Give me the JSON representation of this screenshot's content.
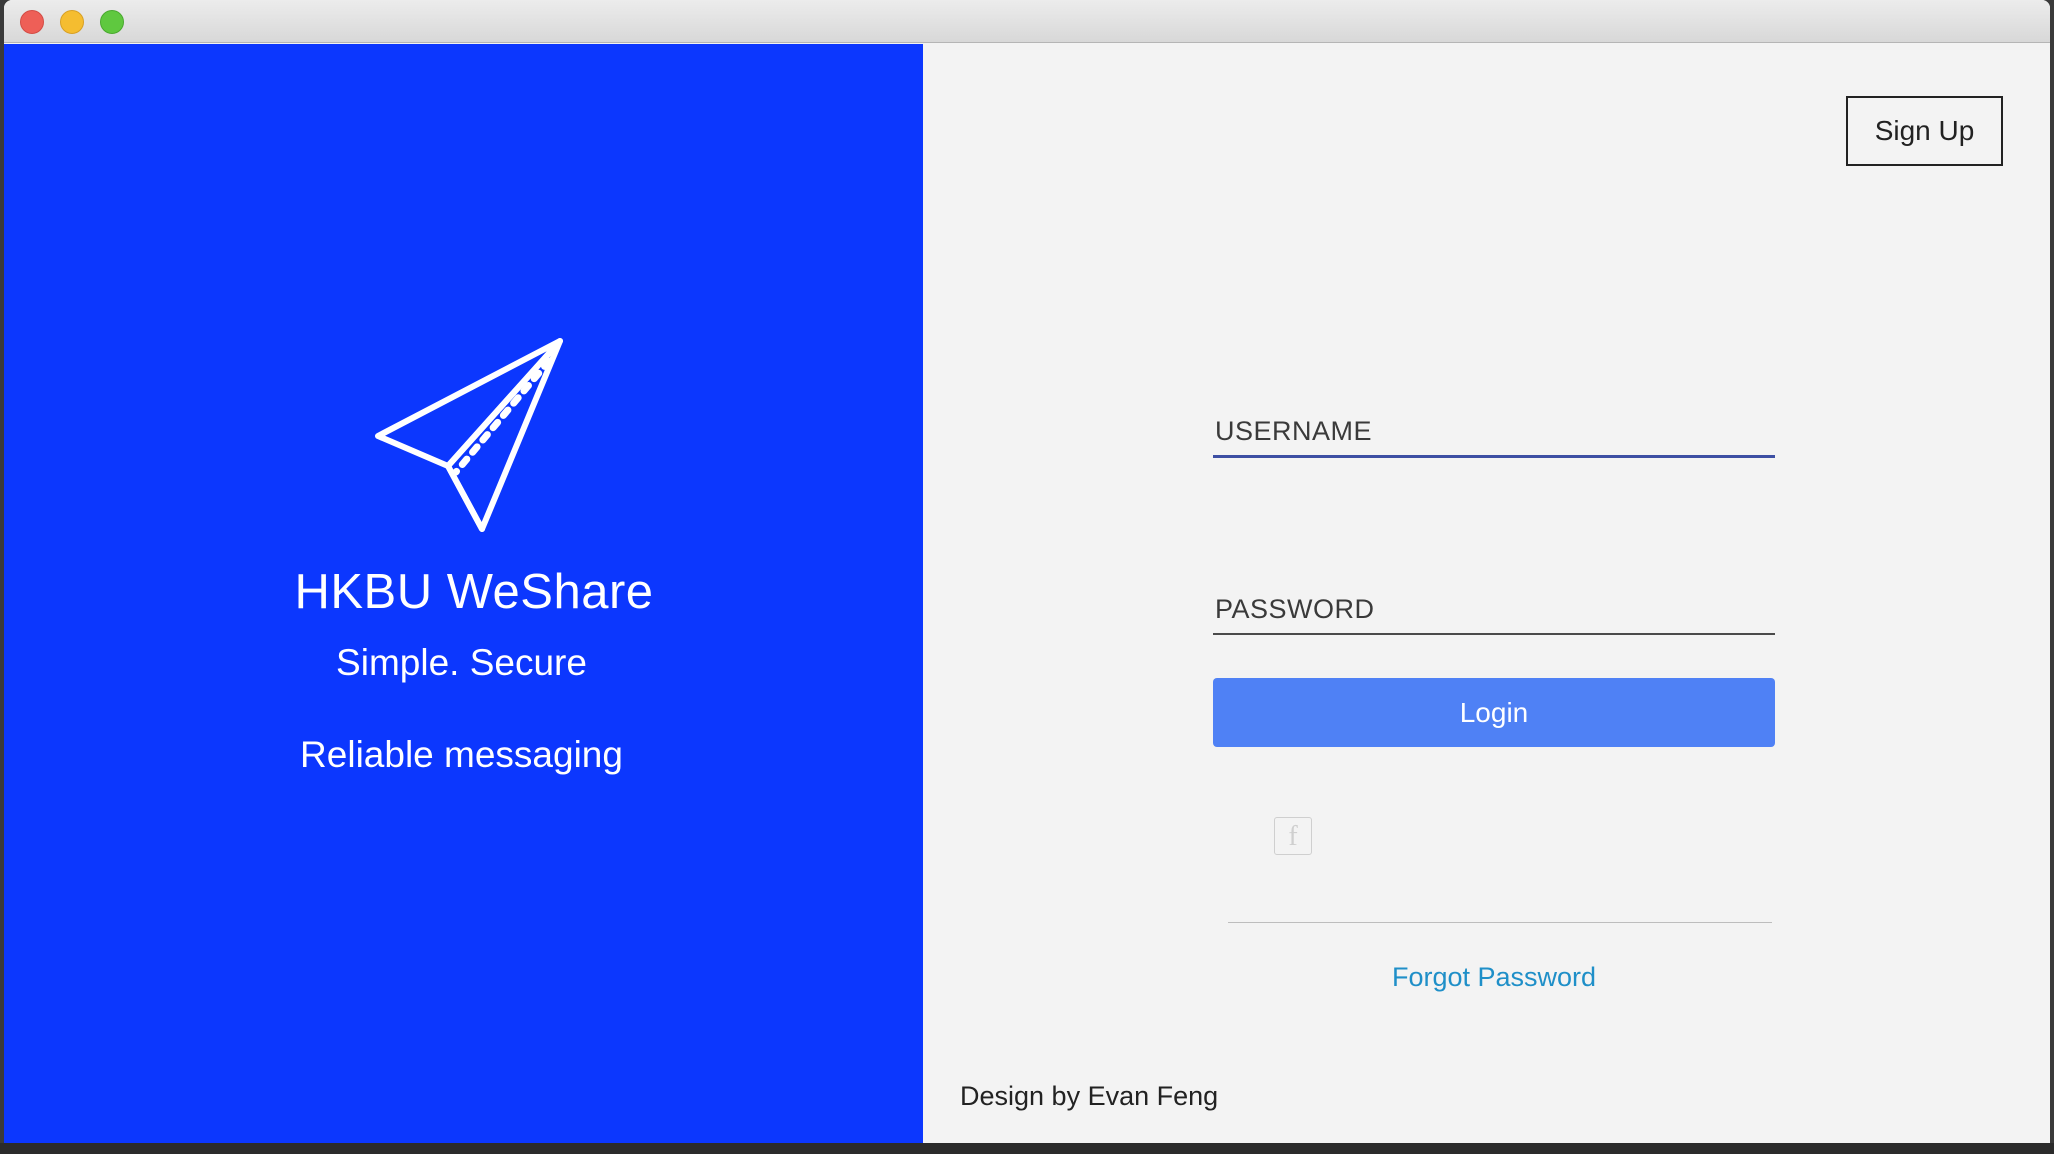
{
  "left_panel": {
    "app_title": "HKBU WeShare",
    "tagline_1": "Simple. Secure",
    "tagline_2": "Reliable messaging",
    "logo_icon": "paper-plane-icon",
    "background_color": "#0c37fe"
  },
  "right_panel": {
    "signup_label": "Sign Up",
    "username_placeholder": "USERNAME",
    "password_placeholder": "PASSWORD",
    "login_label": "Login",
    "social_icon": "facebook-icon",
    "forgot_label": "Forgot Password",
    "credit": "Design by Evan Feng",
    "accent_color": "#4f81f5",
    "link_color": "#1f8fc8"
  }
}
